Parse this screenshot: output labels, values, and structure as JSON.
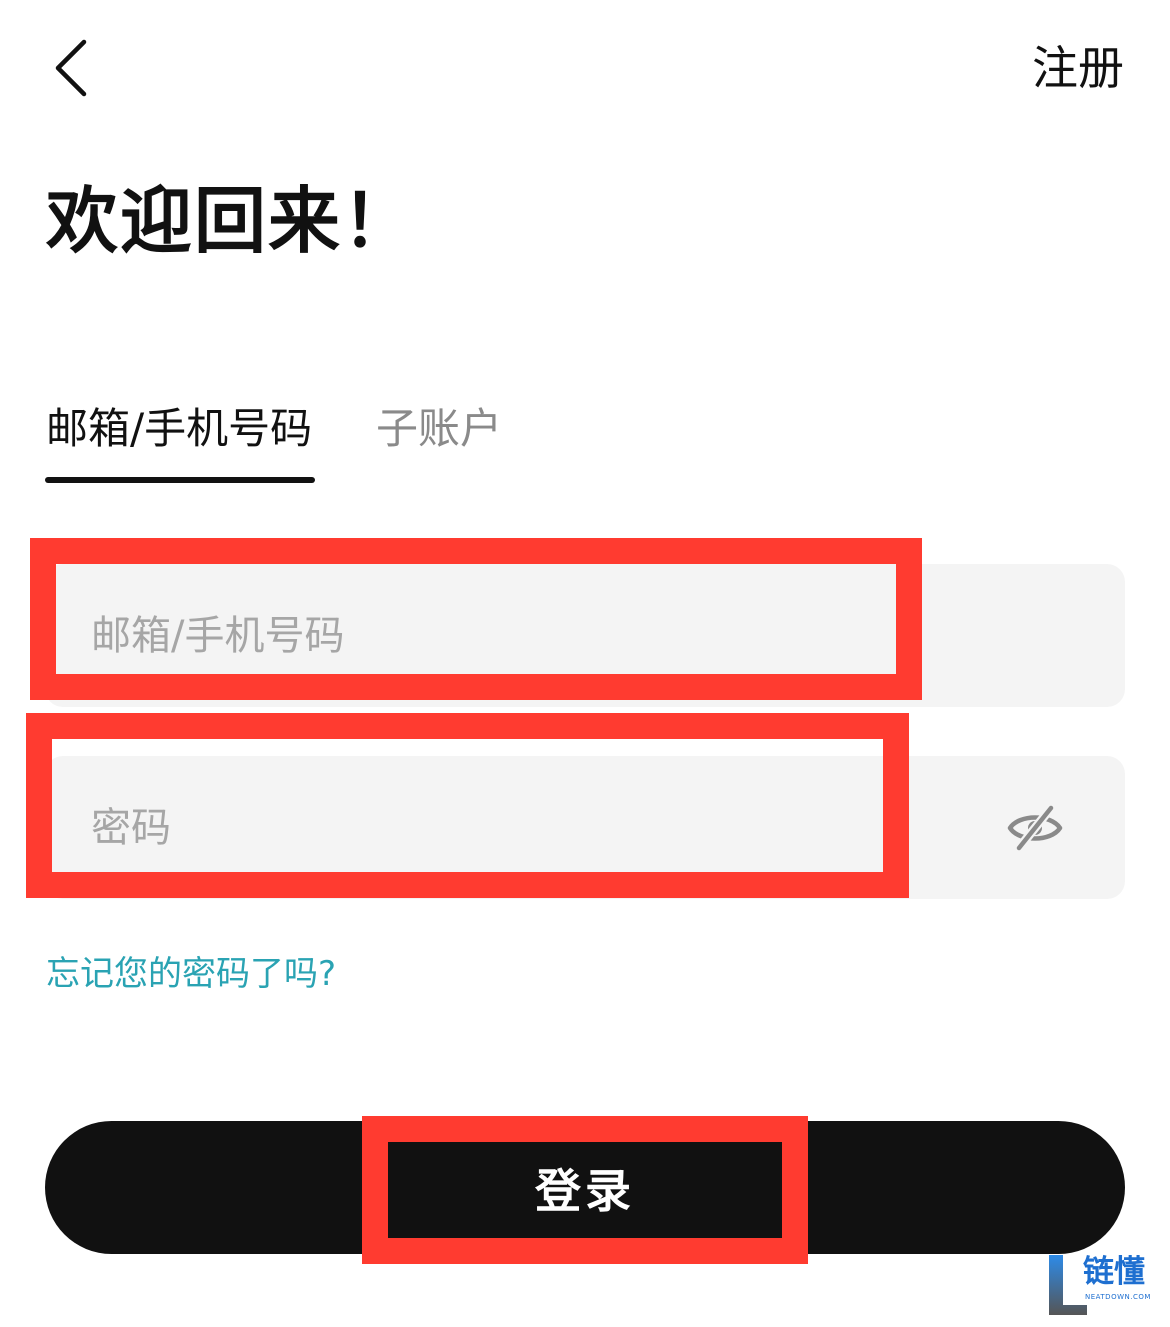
{
  "header": {
    "back_icon": "chevron-left-icon",
    "register_label": "注册"
  },
  "welcome_title": "欢迎回来！",
  "tabs": [
    {
      "label": "邮箱/手机号码",
      "active": true
    },
    {
      "label": "子账户",
      "active": false
    }
  ],
  "form": {
    "email_placeholder": "邮箱/手机号码",
    "email_value": "",
    "password_placeholder": "密码",
    "password_value": "",
    "toggle_visibility_icon": "eye-off-icon",
    "forgot_label": "忘记您的密码了吗?",
    "login_label": "登录"
  },
  "watermark": {
    "brand": "链懂",
    "sub": "NEATDOWN.COM"
  },
  "colors": {
    "accent_link": "#2aa3b3",
    "button": "#111111",
    "field_bg": "#f4f4f4",
    "highlight": "#ff3b30"
  }
}
